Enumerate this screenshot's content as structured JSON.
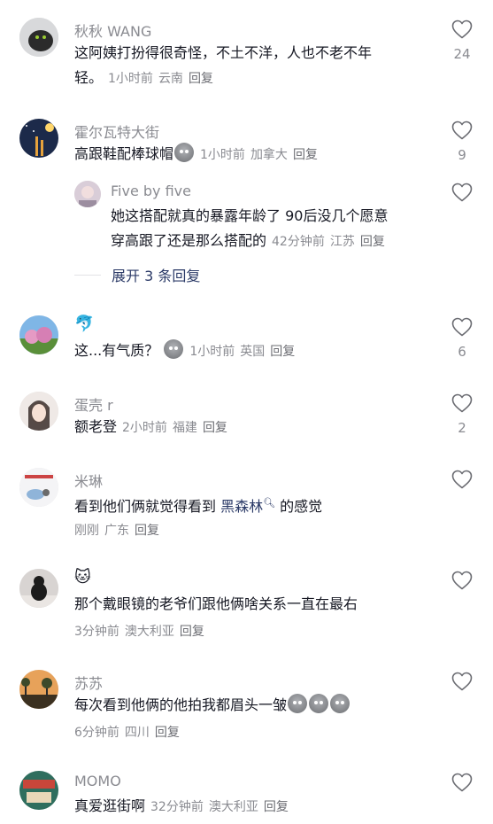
{
  "comments": [
    {
      "user": "秋秋 WANG",
      "text_line1": "这阿姨打扮得很奇怪，不土不洋，人也不老不年",
      "text_line2": "轻。",
      "time": "1小时前",
      "location": "云南",
      "reply": "回复",
      "likes": "24"
    },
    {
      "user": "霍尔瓦特大街",
      "text": "高跟鞋配棒球帽",
      "time": "1小时前",
      "location": "加拿大",
      "reply": "回复",
      "likes": "9",
      "sub_reply": {
        "user": "Five by five",
        "text_line1": "她这搭配就真的暴露年龄了 90后没几个愿意",
        "text_line2": "穿高跟了还是那么搭配的",
        "time": "42分钟前",
        "location": "江苏",
        "reply": "回复"
      },
      "expand_label": "展开 3 条回复"
    },
    {
      "user_emoji": "🐬",
      "text": "这...有气质？",
      "time": "1小时前",
      "location": "英国",
      "reply": "回复",
      "likes": "6"
    },
    {
      "user": "蛋壳 r",
      "text": "额老登",
      "time": "2小时前",
      "location": "福建",
      "reply": "回复",
      "likes": "2"
    },
    {
      "user": "米琳",
      "text_before": "看到他们俩就觉得看到 ",
      "link": "黑森林",
      "text_after": " 的感觉",
      "time": "刚刚",
      "location": "广东",
      "reply": "回复"
    },
    {
      "user_emoji": "🐱",
      "text": "那个戴眼镜的老爷们跟他俩啥关系一直在最右",
      "time": "3分钟前",
      "location": "澳大利亚",
      "reply": "回复"
    },
    {
      "user": "苏苏",
      "text": "每次看到他俩的他拍我都眉头一皱",
      "time": "6分钟前",
      "location": "四川",
      "reply": "回复"
    },
    {
      "user": "MOMO",
      "text": "真爱逛街啊",
      "time": "32分钟前",
      "location": "澳大利亚",
      "reply": "回复"
    }
  ],
  "colors": {
    "name": "#8a8b91",
    "text": "#161823",
    "link": "#2b3a67"
  }
}
